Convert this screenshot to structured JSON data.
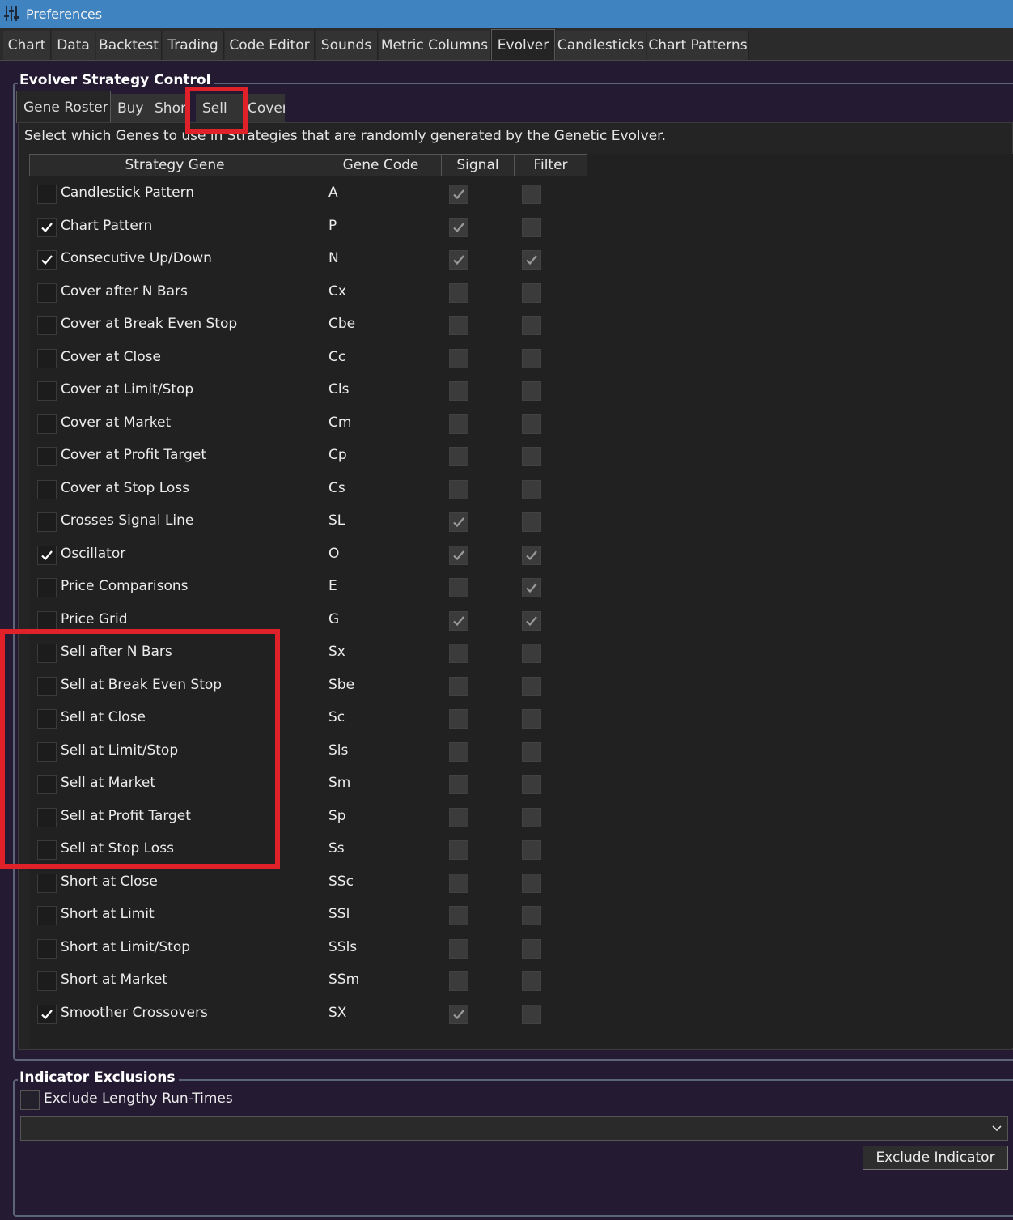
{
  "window": {
    "title": "Preferences",
    "icon": "sliders-icon"
  },
  "main_tabs": [
    "Chart",
    "Data",
    "Backtest",
    "Trading",
    "Code Editor",
    "Sounds",
    "Metric Columns",
    "Evolver",
    "Candlesticks",
    "Chart Patterns"
  ],
  "main_tab_active": "Evolver",
  "strategy_control": {
    "title": "Evolver Strategy Control",
    "sub_tabs": [
      "Gene Roster",
      "Buy",
      "Shor",
      "Sell",
      "Cover"
    ],
    "sub_tab_active": "Gene Roster",
    "description": "Select which Genes to use in Strategies that are randomly generated by the Genetic Evolver.",
    "columns": [
      "Strategy Gene",
      "Gene Code",
      "Signal",
      "Filter"
    ],
    "rows": [
      {
        "name": "Candlestick Pattern",
        "code": "A",
        "enabled": false,
        "signal": true,
        "filter": false
      },
      {
        "name": "Chart Pattern",
        "code": "P",
        "enabled": true,
        "signal": true,
        "filter": false
      },
      {
        "name": "Consecutive Up/Down",
        "code": "N",
        "enabled": true,
        "signal": true,
        "filter": true
      },
      {
        "name": "Cover after N Bars",
        "code": "Cx",
        "enabled": false,
        "signal": false,
        "filter": false
      },
      {
        "name": "Cover at Break Even Stop",
        "code": "Cbe",
        "enabled": false,
        "signal": false,
        "filter": false
      },
      {
        "name": "Cover at Close",
        "code": "Cc",
        "enabled": false,
        "signal": false,
        "filter": false
      },
      {
        "name": "Cover at Limit/Stop",
        "code": "Cls",
        "enabled": false,
        "signal": false,
        "filter": false
      },
      {
        "name": "Cover at Market",
        "code": "Cm",
        "enabled": false,
        "signal": false,
        "filter": false
      },
      {
        "name": "Cover at Profit Target",
        "code": "Cp",
        "enabled": false,
        "signal": false,
        "filter": false
      },
      {
        "name": "Cover at Stop Loss",
        "code": "Cs",
        "enabled": false,
        "signal": false,
        "filter": false
      },
      {
        "name": "Crosses Signal Line",
        "code": "SL",
        "enabled": false,
        "signal": true,
        "filter": false
      },
      {
        "name": "Oscillator",
        "code": "O",
        "enabled": true,
        "signal": true,
        "filter": true
      },
      {
        "name": "Price Comparisons",
        "code": "E",
        "enabled": false,
        "signal": false,
        "filter": true
      },
      {
        "name": "Price Grid",
        "code": "G",
        "enabled": false,
        "signal": true,
        "filter": true
      },
      {
        "name": "Sell after N Bars",
        "code": "Sx",
        "enabled": false,
        "signal": false,
        "filter": false
      },
      {
        "name": "Sell at Break Even Stop",
        "code": "Sbe",
        "enabled": false,
        "signal": false,
        "filter": false
      },
      {
        "name": "Sell at Close",
        "code": "Sc",
        "enabled": false,
        "signal": false,
        "filter": false
      },
      {
        "name": "Sell at Limit/Stop",
        "code": "Sls",
        "enabled": false,
        "signal": false,
        "filter": false
      },
      {
        "name": "Sell at Market",
        "code": "Sm",
        "enabled": false,
        "signal": false,
        "filter": false
      },
      {
        "name": "Sell at Profit Target",
        "code": "Sp",
        "enabled": false,
        "signal": false,
        "filter": false
      },
      {
        "name": "Sell at Stop Loss",
        "code": "Ss",
        "enabled": false,
        "signal": false,
        "filter": false
      },
      {
        "name": "Short at Close",
        "code": "SSc",
        "enabled": false,
        "signal": false,
        "filter": false
      },
      {
        "name": "Short at Limit",
        "code": "SSl",
        "enabled": false,
        "signal": false,
        "filter": false
      },
      {
        "name": "Short at Limit/Stop",
        "code": "SSls",
        "enabled": false,
        "signal": false,
        "filter": false
      },
      {
        "name": "Short at Market",
        "code": "SSm",
        "enabled": false,
        "signal": false,
        "filter": false
      },
      {
        "name": "Smoother Crossovers",
        "code": "SX",
        "enabled": true,
        "signal": true,
        "filter": false
      }
    ]
  },
  "indicator_exclusions": {
    "title": "Indicator Exclusions",
    "checkbox_label": "Exclude Lengthy Run-Times",
    "checkbox_checked": false,
    "combo_value": "",
    "button_label": "Exclude Indicator"
  },
  "colors": {
    "titlebar": "#3f84c0",
    "background": "#241b33",
    "highlight": "#e0212a"
  }
}
